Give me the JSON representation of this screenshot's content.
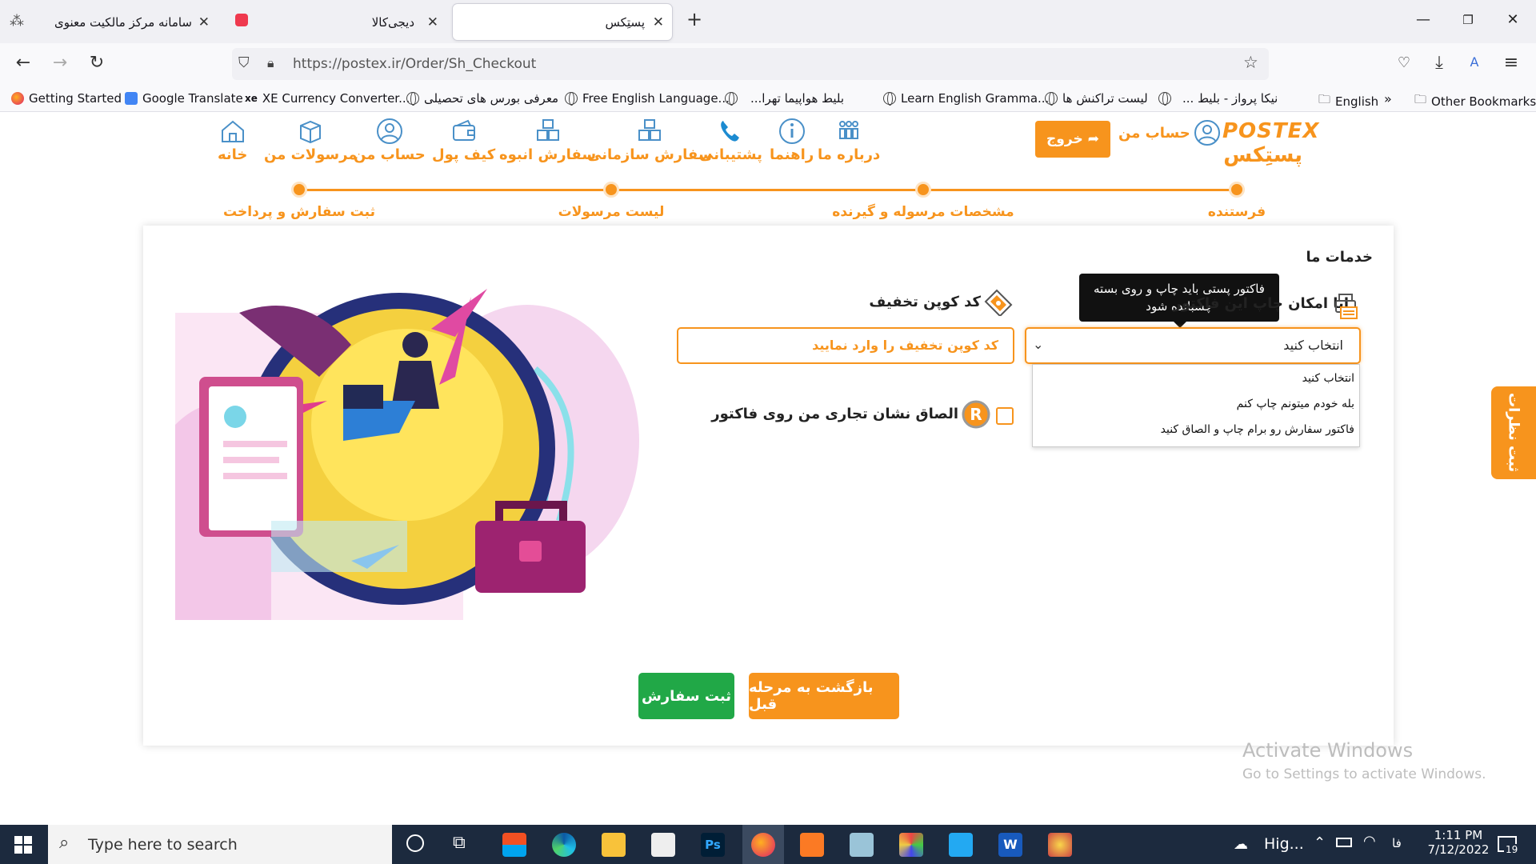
{
  "browser": {
    "tabs": [
      {
        "label": "سامانه مرکز مالکیت معنوی"
      },
      {
        "label": "دیجی‌کالا"
      },
      {
        "label": "پستِکس"
      }
    ],
    "url": "https://postex.ir/Order/Sh_Checkout",
    "bookmarks": [
      "Getting Started",
      "Google Translate",
      "XE Currency Converter...",
      "معرفی بورس های تحصیلی",
      "Free English Language...",
      "بلیط هواپیما تهرا...",
      "Learn English Gramma...",
      "لیست تراکنش ها",
      "نیکا پرواز - بلیط ...",
      "English",
      "Other Bookmarks"
    ]
  },
  "site": {
    "logo_latin": "POSTEX",
    "logo_fa": "پستِکس",
    "exit_label": "خروج",
    "account_label": "حساب من",
    "nav": [
      {
        "label": "خانه",
        "icon": "home-icon"
      },
      {
        "label": "مرسولات من",
        "icon": "box-icon"
      },
      {
        "label": "حساب من",
        "icon": "user-icon"
      },
      {
        "label": "کیف پول",
        "icon": "wallet-icon"
      },
      {
        "label": "سفارش انبوه",
        "icon": "boxes-icon"
      },
      {
        "label": "سفارش سازمانی",
        "icon": "org-boxes-icon"
      },
      {
        "label": "پشتیبانی",
        "icon": "phone-icon"
      },
      {
        "label": "راهنما",
        "icon": "info-icon"
      },
      {
        "label": "درباره ما",
        "icon": "team-icon"
      }
    ],
    "steps": [
      "ثبت سفارش و پرداخت",
      "لیست مرسولات",
      "مشخصات مرسوله و گیرنده",
      "فرستنده"
    ],
    "section_title": "خدمات ما",
    "print_question": "ایا امکان چاپ این فاکتور",
    "tooltip": "فاکتور پستی باید چاپ و روی بسته چسبانده شود",
    "select_value": "انتخاب کنید",
    "select_options": [
      "انتخاب کنید",
      "بله خودم میتونم چاپ کنم",
      "فاکتور سفارش رو برام چاپ و الصاق کنید"
    ],
    "coupon_label": "کد کوپن تخفیف",
    "coupon_placeholder": "کد کوپن تخفیف را وارد نمایید",
    "trademark_label": "الصاق نشان تجاری من روی فاکتور",
    "btn_back": "بازگشت به مرحله قبل",
    "btn_submit": "ثبت سفارش",
    "side_tab": "ثبت نظرات"
  },
  "watermark": {
    "line1": "Activate Windows",
    "line2": "Go to Settings to activate Windows."
  },
  "taskbar": {
    "search_placeholder": "Type here to search",
    "tray_text": "Hig...",
    "lang": "فا",
    "time": "1:11 PM",
    "date": "7/12/2022",
    "notif_count": "19"
  },
  "colors": {
    "accent": "#f7941d",
    "green": "#21a847"
  }
}
